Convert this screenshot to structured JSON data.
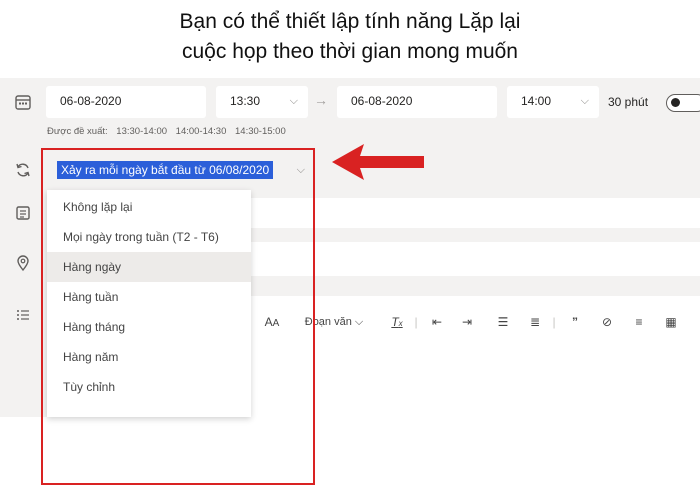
{
  "caption": {
    "line1": "Bạn có thể thiết lập tính năng Lặp lại",
    "line2": "cuộc họp theo thời gian mong muốn"
  },
  "schedule": {
    "start_date": "06-08-2020",
    "start_time": "13:30",
    "end_date": "06-08-2020",
    "end_time": "14:00",
    "duration": "30 phút",
    "suggested_label": "Được đề xuất:",
    "suggested_slots": [
      "13:30-14:00",
      "14:00-14:30",
      "14:30-15:00"
    ]
  },
  "recurrence": {
    "selected": "Xảy ra mỗi ngày bắt đầu từ 06/08/2020",
    "options": [
      "Không lặp lại",
      "Mọi ngày trong tuần (T2 - T6)",
      "Hàng ngày",
      "Hàng tuần",
      "Hàng tháng",
      "Hàng năm",
      "Tùy chỉnh"
    ],
    "highlighted_index": 2
  },
  "toolbar": {
    "font_size": "A",
    "paragraph": "Đoạn văn",
    "clear_format": "T"
  },
  "colors": {
    "accent_red": "#d92222",
    "selection_blue": "#2b5fd9",
    "panel_bg": "#f3f2f1"
  },
  "icons": [
    "calendar-icon",
    "repeat-icon",
    "channel-icon",
    "location-icon",
    "list-icon",
    "arrow-right-icon"
  ]
}
